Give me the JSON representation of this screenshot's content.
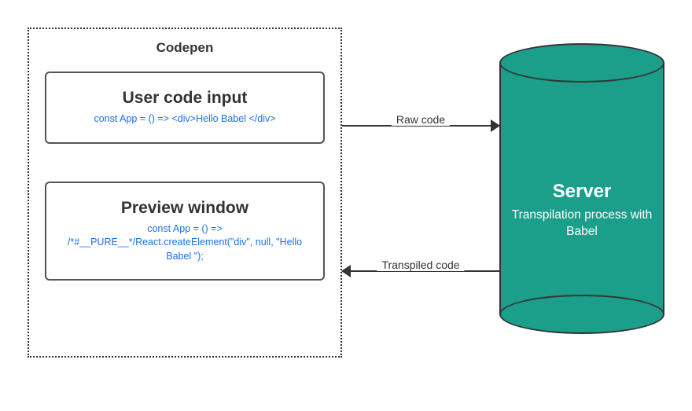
{
  "codepen": {
    "title": "Codepen",
    "input_panel": {
      "title": "User code input",
      "code": "const App = () => <div>Hello Babel </div>"
    },
    "preview_panel": {
      "title": "Preview window",
      "code": "const App = () => /*#__PURE__*/React.createElement(\"div\", null, \"Hello Babel \");"
    }
  },
  "server": {
    "title": "Server",
    "subtitle": "Transpilation process with Babel"
  },
  "arrows": {
    "to_server": "Raw code",
    "from_server": "Transpiled code"
  },
  "colors": {
    "server_fill": "#1b9e8a",
    "code_text": "#1a73e8",
    "stroke": "#333333"
  }
}
